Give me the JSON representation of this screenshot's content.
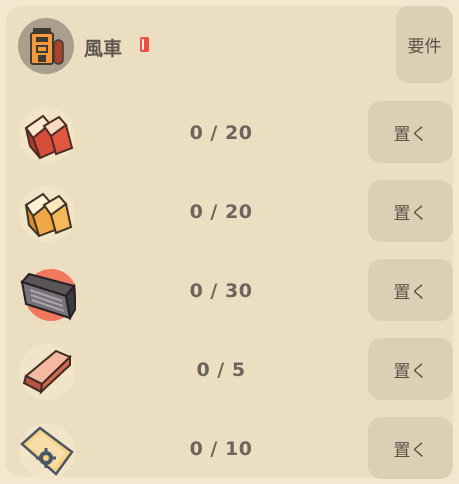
{
  "building": {
    "name": "風車",
    "icon": "windmill-building-icon"
  },
  "requirements_button": "要件",
  "colors": {
    "background": "#f3e8cf",
    "panel": "#ecdfc1",
    "button": "#dbd0b4",
    "text": "#5f574f",
    "badge_red": "#ef4f45"
  },
  "materials": [
    {
      "icon": "red-crystal-icon",
      "count": "0 / 20",
      "button": "置く"
    },
    {
      "icon": "yellow-crystal-icon",
      "count": "0 / 20",
      "button": "置く"
    },
    {
      "icon": "metal-plate-icon",
      "count": "0 / 30",
      "button": "置く"
    },
    {
      "icon": "copper-ingot-icon",
      "count": "0 / 5",
      "button": "置く"
    },
    {
      "icon": "gear-card-icon",
      "count": "0 / 10",
      "button": "置く"
    }
  ]
}
